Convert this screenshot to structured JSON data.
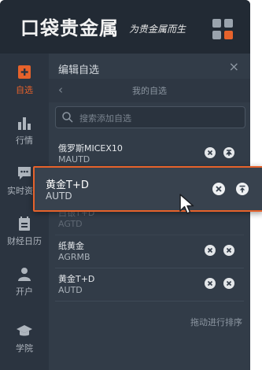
{
  "header": {
    "logo_text": "口袋贵金属",
    "slogan": "为贵金属而生"
  },
  "sidebar": {
    "items": [
      {
        "label": "自选",
        "icon": "plus-square-icon",
        "active": true
      },
      {
        "label": "行情",
        "icon": "bar-chart-icon",
        "active": false
      },
      {
        "label": "实时资讯",
        "icon": "chat-bubble-icon",
        "active": false
      },
      {
        "label": "财经日历",
        "icon": "calendar-icon",
        "active": false
      },
      {
        "label": "开户",
        "icon": "person-icon",
        "active": false
      },
      {
        "label": "学院",
        "icon": "graduation-cap-icon",
        "active": false
      }
    ]
  },
  "panel": {
    "title": "编辑自选",
    "close": "×",
    "back": "‹",
    "subtitle": "我的自选",
    "search_placeholder": "搜索添加自选",
    "footer_hint": "拖动进行排序"
  },
  "list": [
    {
      "name": "俄罗斯MICEX10",
      "code": "MAUTD"
    },
    {
      "name": "白银T+D",
      "code": "AGTD"
    },
    {
      "name": "纸黄金",
      "code": "AGRMB"
    },
    {
      "name": "黄金T+D",
      "code": "AUTD"
    }
  ],
  "dragging": {
    "name": "黄金T+D",
    "code": "AUTD"
  },
  "colors": {
    "accent": "#e6622b",
    "panel": "#323c48",
    "header": "#222a34"
  }
}
